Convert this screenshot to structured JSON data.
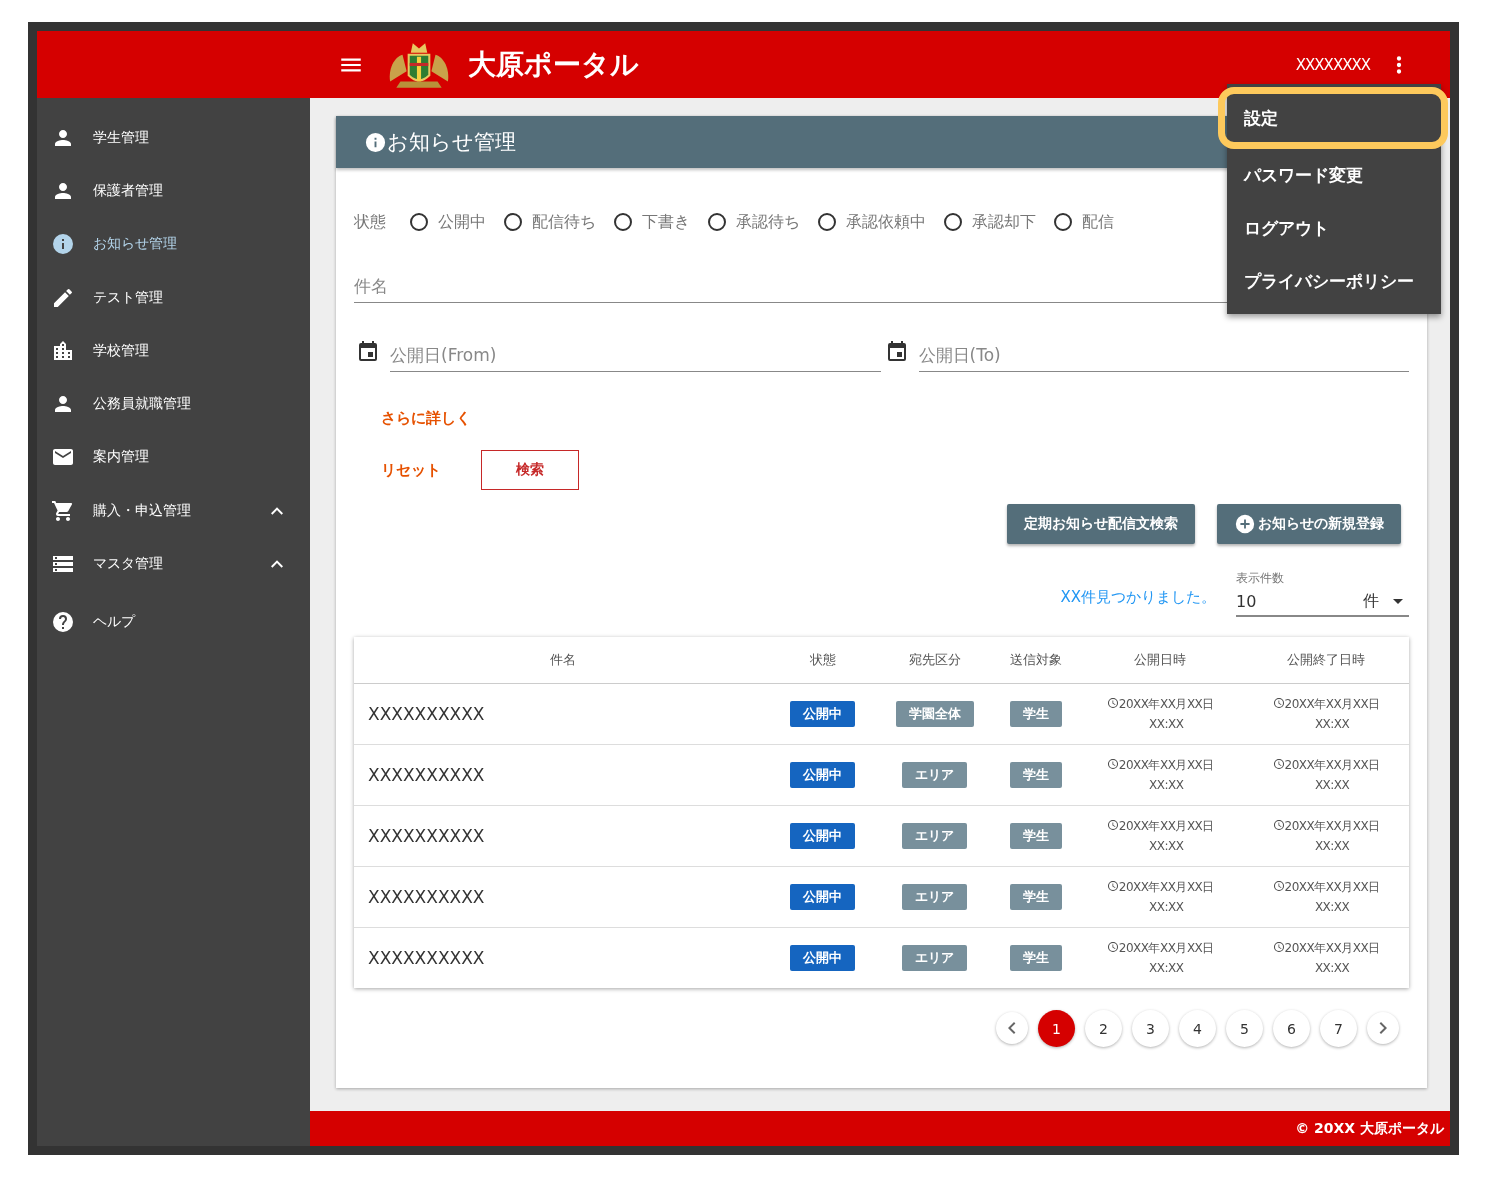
{
  "header": {
    "title": "大原ポータル",
    "user": "XXXXXXXX"
  },
  "user_menu": {
    "items": [
      {
        "label": "設定",
        "highlighted": true
      },
      {
        "label": "パスワード変更",
        "highlighted": false
      },
      {
        "label": "ログアウト",
        "highlighted": false
      },
      {
        "label": "プライバシーポリシー",
        "highlighted": false
      }
    ]
  },
  "sidebar": {
    "items": [
      {
        "label": "学生管理",
        "selected": false
      },
      {
        "label": "保護者管理",
        "selected": false
      },
      {
        "label": "お知らせ管理",
        "selected": true
      },
      {
        "label": "テスト管理",
        "selected": false
      },
      {
        "label": "学校管理",
        "selected": false
      },
      {
        "label": "公務員就職管理",
        "selected": false
      },
      {
        "label": "案内管理",
        "selected": false
      },
      {
        "label": "購入・申込管理",
        "selected": false,
        "expanded": true
      },
      {
        "label": "マスタ管理",
        "selected": false,
        "expanded": true
      },
      {
        "label": "ヘルプ",
        "selected": false
      }
    ]
  },
  "page": {
    "title": "お知らせ管理"
  },
  "filters": {
    "status_label": "状態",
    "status_options": [
      {
        "label": "公開中",
        "selected": false
      },
      {
        "label": "配信待ち",
        "selected": false
      },
      {
        "label": "下書き",
        "selected": false
      },
      {
        "label": "承認待ち",
        "selected": false
      },
      {
        "label": "承認依頼中",
        "selected": false
      },
      {
        "label": "承認却下",
        "selected": false
      },
      {
        "label": "配信",
        "selected": false
      }
    ],
    "subject": {
      "placeholder": "件名"
    },
    "date_from": {
      "placeholder": "公開日(From)"
    },
    "date_to": {
      "placeholder": "公開日(To)"
    },
    "more_link": "さらに詳しく",
    "reset": "リセット",
    "search": "検索"
  },
  "actions": [
    {
      "label": "定期お知らせ配信文検索",
      "kind": "plain"
    },
    {
      "label": "お知らせの新規登録",
      "kind": "add"
    }
  ],
  "result_count": "XX件見つかりました。",
  "page_size": {
    "label": "表示件数",
    "value": "10",
    "unit": "件"
  },
  "table": {
    "columns": [
      "件名",
      "状態",
      "宛先区分",
      "送信対象",
      "公開日時",
      "公開終了日時"
    ],
    "rows": [
      {
        "subject": "XXXXXXXXXX",
        "status": "公開中",
        "destination": "学園全体",
        "target": "学生",
        "published_date": "20XX年XX月XX日",
        "published_time": "XX:XX",
        "end_date": "20XX年XX月XX日",
        "end_time": "XX:XX"
      },
      {
        "subject": "XXXXXXXXXX",
        "status": "公開中",
        "destination": "エリア",
        "target": "学生",
        "published_date": "20XX年XX月XX日",
        "published_time": "XX:XX",
        "end_date": "20XX年XX月XX日",
        "end_time": "XX:XX"
      },
      {
        "subject": "XXXXXXXXXX",
        "status": "公開中",
        "destination": "エリア",
        "target": "学生",
        "published_date": "20XX年XX月XX日",
        "published_time": "XX:XX",
        "end_date": "20XX年XX月XX日",
        "end_time": "XX:XX"
      },
      {
        "subject": "XXXXXXXXXX",
        "status": "公開中",
        "destination": "エリア",
        "target": "学生",
        "published_date": "20XX年XX月XX日",
        "published_time": "XX:XX",
        "end_date": "20XX年XX月XX日",
        "end_time": "XX:XX"
      },
      {
        "subject": "XXXXXXXXXX",
        "status": "公開中",
        "destination": "エリア",
        "target": "学生",
        "published_date": "20XX年XX月XX日",
        "published_time": "XX:XX",
        "end_date": "20XX年XX月XX日",
        "end_time": "XX:XX"
      }
    ]
  },
  "pagination": {
    "pages": [
      {
        "label": "1",
        "selected": true
      },
      {
        "label": "2",
        "selected": false
      },
      {
        "label": "3",
        "selected": false
      },
      {
        "label": "4",
        "selected": false
      },
      {
        "label": "5",
        "selected": false
      },
      {
        "label": "6",
        "selected": false
      },
      {
        "label": "7",
        "selected": false
      }
    ]
  },
  "footer": "© 20XX 大原ポータル"
}
